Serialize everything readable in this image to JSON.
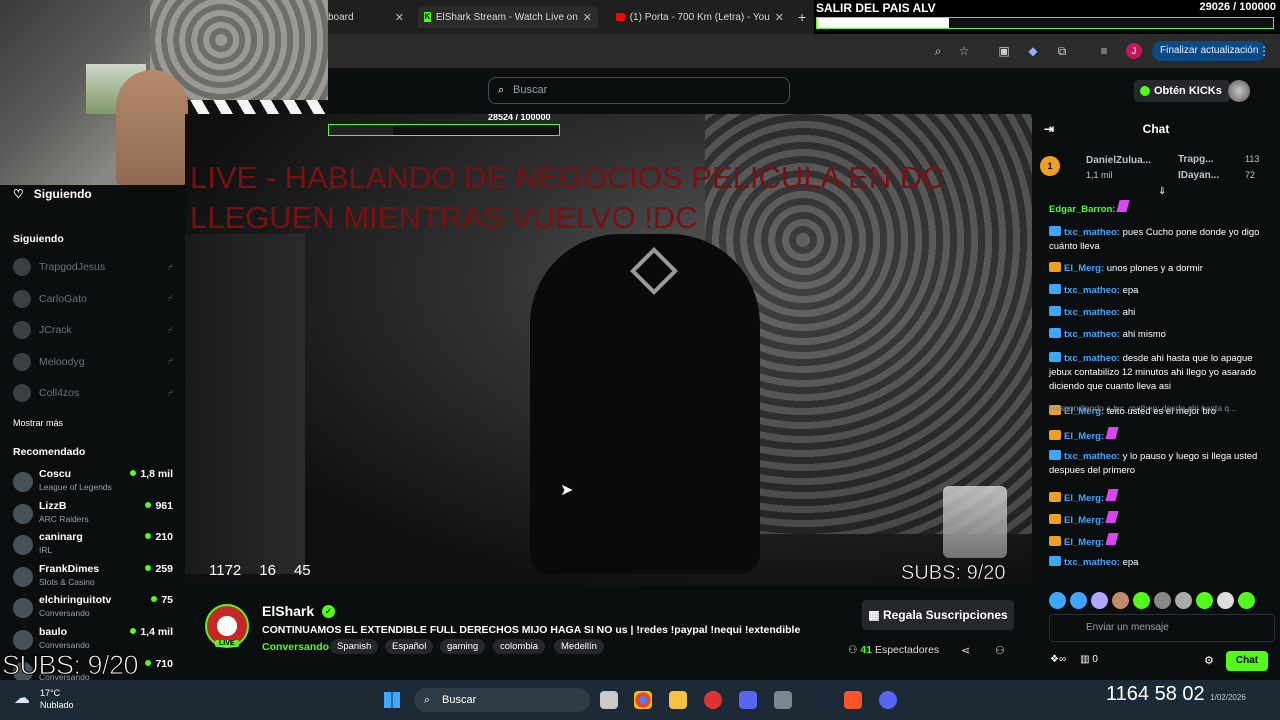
{
  "browser": {
    "tabs": [
      {
        "label": "board",
        "active": false
      },
      {
        "label": "ElShark Stream - Watch Live on",
        "active": true
      },
      {
        "label": "(1) Porta - 700 Km (Letra) - You",
        "active": false
      }
    ],
    "update_button": "Finalizar actualización",
    "profile_initial": "J"
  },
  "goal_top": {
    "title": "SALIR DEL PAIS ALV",
    "count": "29026 / 100000",
    "progress": 0.29
  },
  "kick_header": {
    "search_placeholder": "Buscar",
    "kicks_button": "Obtén KICKs"
  },
  "sidebar": {
    "following_title": "Siguiendo",
    "following_heading": "Siguiendo",
    "following": [
      "TrapgodJesus",
      "CarloGato",
      "JCrack",
      "Meloodyg",
      "Coll4zos"
    ],
    "show_more": "Mostrar más",
    "recommended_heading": "Recomendado",
    "recommended": [
      {
        "name": "Coscu",
        "category": "League of Legends",
        "viewers": "1,8 mil"
      },
      {
        "name": "LizzB",
        "category": "ARC Raiders",
        "viewers": "961"
      },
      {
        "name": "caninarg",
        "category": "IRL",
        "viewers": "210"
      },
      {
        "name": "FrankDimes",
        "category": "Slots & Casino",
        "viewers": "259"
      },
      {
        "name": "elchiringuitotv",
        "category": "Conversando",
        "viewers": "75"
      },
      {
        "name": "baulo",
        "category": "Conversando",
        "viewers": "1,4 mil"
      },
      {
        "name": "",
        "category": "Conversando",
        "viewers": "710"
      }
    ],
    "subs_overlay": "SUBS: 9/20"
  },
  "video": {
    "overlay_line1": "LIVE - HABLANDO DE NEGOCIOS PELICULA EN DC",
    "overlay_line2": "LLEGUEN MIENTRAS VUELVO !DC",
    "goal_small_count": "28524 / 100000",
    "goal_small_progress": 0.28,
    "counters": [
      "1172",
      "16",
      "45"
    ],
    "subs": "SUBS: 9/20"
  },
  "info": {
    "channel": "ElShark",
    "live_label": "LIVE",
    "title": "CONTINUAMOS EL EXTENDIBLE FULL DERECHOS MIJO HAGA SI NO us | !redes !paypal !nequi !extendible",
    "category": "Conversando",
    "tags": [
      "Spanish",
      "Español",
      "gaming",
      "colombia",
      "Medellín"
    ],
    "sub_button": "Regala Suscripciones",
    "viewers_count": "41",
    "viewers_label": "Espectadores"
  },
  "chat": {
    "title": "Chat",
    "pinned": {
      "user": "DanielZulua...",
      "amount": "1,1 mil",
      "rank_badge": "1",
      "top2_name": "Trapg...",
      "top2_value": "113",
      "top3_name": "IDayan...",
      "top3_value": "72"
    },
    "messages": [
      {
        "user": "Edgar_Barron:",
        "text": "",
        "color": "#53fc18",
        "badge": "none"
      },
      {
        "user": "txc_matheo:",
        "text": "pues Cucho pone donde yo digo cuánto lleva",
        "color": "#3ea6ff",
        "badge": "blue"
      },
      {
        "user": "El_Merg:",
        "text": "unos plones y a dormir",
        "color": "#3ea6ff",
        "badge": "gold"
      },
      {
        "user": "txc_matheo:",
        "text": "epa",
        "color": "#3ea6ff",
        "badge": "blue"
      },
      {
        "user": "txc_matheo:",
        "text": "ahi",
        "color": "#3ea6ff",
        "badge": "blue"
      },
      {
        "user": "txc_matheo:",
        "text": "ahi mismo",
        "color": "#3ea6ff",
        "badge": "blue"
      },
      {
        "user": "txc_matheo:",
        "text": "desde ahi hasta que lo apague jebux contabilizo 12 minutos ahi llego yo asarado diciendo que cuanto lleva asi",
        "color": "#3ea6ff",
        "badge": "blue"
      },
      {
        "user": "El_Merg:",
        "text": "teito usted es el mejor bro",
        "color": "#3ea6ff",
        "badge": "gold"
      },
      {
        "user": "El_Merg:",
        "text": "",
        "color": "#3ea6ff",
        "badge": "gold"
      },
      {
        "user": "txc_matheo:",
        "text": "y lo pauso y luego si llega usted despues del primero",
        "color": "#3ea6ff",
        "badge": "blue"
      },
      {
        "user": "El_Merg:",
        "text": "",
        "color": "#3ea6ff",
        "badge": "gold"
      },
      {
        "user": "El_Merg:",
        "text": "",
        "color": "#3ea6ff",
        "badge": "gold"
      },
      {
        "user": "El_Merg:",
        "text": "",
        "color": "#3ea6ff",
        "badge": "gold"
      },
      {
        "user": "txc_matheo:",
        "text": "epa",
        "color": "#3ea6ff",
        "badge": "blue"
      }
    ],
    "reply_note": "Respondiendo a txc_matheo: desde ahi hasta q...",
    "input_placeholder": "Enviar un mensaje",
    "send_button": "Chat",
    "footer_kicks": "0"
  },
  "taskbar": {
    "temp": "17°C",
    "condition": "Nublado",
    "search": "Buscar",
    "overlay_big": "1164  58  02",
    "date": "1/02/2026"
  },
  "colors": {
    "kick_green": "#53fc18",
    "bg": "#0b0e0f",
    "overlay_red": "#7a1010"
  }
}
